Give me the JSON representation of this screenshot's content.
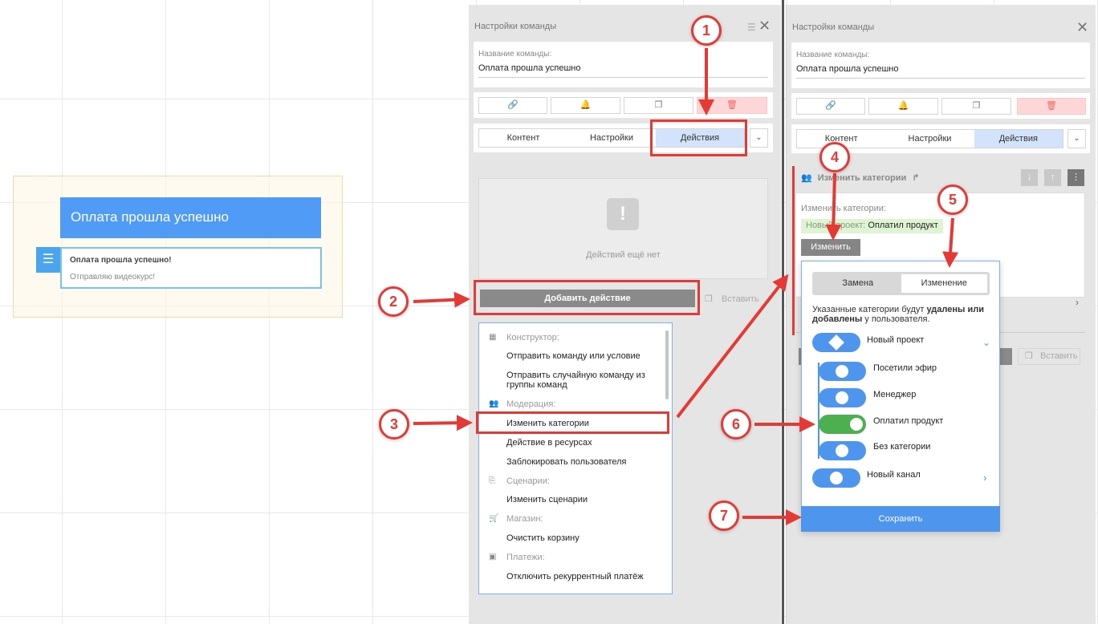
{
  "canvas": {
    "node_title": "Оплата прошла успешно",
    "msg_title": "Оплата прошла успешно!",
    "msg_text": "Отправляю видеокурс!"
  },
  "panel_a": {
    "title": "Настройки команды",
    "name_label": "Название команды:",
    "name_value": "Оплата прошла успешно",
    "tabs": [
      "Контент",
      "Настройки",
      "Действия"
    ],
    "empty_text": "Действий ещё нет",
    "add_action": "Добавить действие",
    "paste": "Вставить"
  },
  "dropdown": {
    "groups": [
      {
        "icon": "grid-icon",
        "label": "Конструктор:",
        "items": [
          "Отправить команду или условие",
          "Отправить случайную команду из группы команд"
        ]
      },
      {
        "icon": "users-icon",
        "label": "Модерация:",
        "items": [
          "Изменить категории",
          "Действие в ресурсах",
          "Заблокировать пользователя"
        ]
      },
      {
        "icon": "scenario-icon",
        "label": "Сценарии:",
        "items": [
          "Изменить сценарии"
        ]
      },
      {
        "icon": "cart-icon",
        "label": "Магазин:",
        "items": [
          "Очистить корзину"
        ]
      },
      {
        "icon": "payment-icon",
        "label": "Платежи:",
        "items": [
          "Отключить рекуррентный платёж"
        ]
      }
    ]
  },
  "panel_b": {
    "title": "Настройки команды",
    "name_label": "Название команды:",
    "name_value": "Оплата прошла успешно",
    "tabs": [
      "Контент",
      "Настройки",
      "Действия"
    ],
    "action_head": "Изменить категории",
    "action_label": "Изменить категории:",
    "tag_project": "Новый проект:",
    "tag_category": "Оплатил продукт",
    "change_btn": "Изменить",
    "paste": "Вставить"
  },
  "popup": {
    "seg": [
      "Замена",
      "Изменение"
    ],
    "desc_1": "Указанные категории будут ",
    "desc_bold": "удалены или добавлены",
    "desc_2": " у пользователя.",
    "project": "Новый проект",
    "categories": [
      {
        "label": "Посетили эфир",
        "state": "neutral"
      },
      {
        "label": "Менеджер",
        "state": "neutral"
      },
      {
        "label": "Оплатил продукт",
        "state": "on"
      },
      {
        "label": "Без категории",
        "state": "neutral"
      }
    ],
    "channel": "Новый канал",
    "save": "Сохранить"
  },
  "annotations": [
    "1",
    "2",
    "3",
    "4",
    "5",
    "6",
    "7"
  ],
  "colors": {
    "accent": "#4e95ee",
    "annotation": "#e53935",
    "toggle_on": "#4caf50"
  }
}
